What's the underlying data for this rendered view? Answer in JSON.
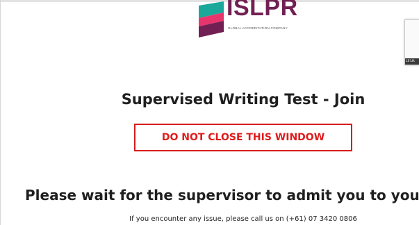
{
  "logo": {
    "brand_name": "ISLPR",
    "tagline": "GLOBAL ACCREDITATION COMPANY",
    "mark_colors": [
      "#1aa89b",
      "#e8356d",
      "#722053"
    ]
  },
  "video_preview": {
    "caption": "Lil Lik"
  },
  "main": {
    "title": "Supervised Writing Test - Join",
    "warning": "DO NOT CLOSE THIS WINDOW",
    "headline": "Please wait for the supervisor to admit you to your writte",
    "contact": "If you encounter any issue, please call us on (+61) 07 3420 0806"
  },
  "colors": {
    "warning_red": "#e01b1b",
    "brand_purple": "#722053",
    "text_dark": "#1f1f1f"
  }
}
